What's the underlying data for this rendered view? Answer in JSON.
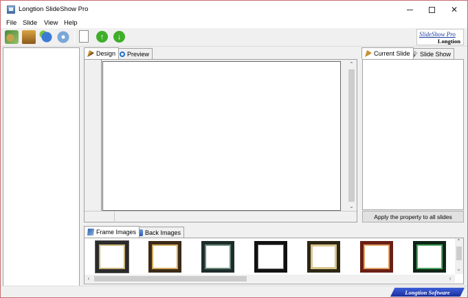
{
  "window": {
    "title": "Longtion SlideShow Pro"
  },
  "menu": {
    "items": [
      "File",
      "Slide",
      "View",
      "Help"
    ]
  },
  "toolbar": {
    "icons": [
      "open-project-icon",
      "save-project-icon",
      "publish-web-icon",
      "burn-disc-icon",
      "new-page-icon",
      "move-up-icon",
      "move-down-icon"
    ]
  },
  "logo": {
    "line1": "SlideShow Pro",
    "line2": "Longtion"
  },
  "center_tabs": [
    "Design",
    "Preview"
  ],
  "right_tabs": [
    "Current Slide",
    "Slide Show"
  ],
  "apply_button": "Apply the property to all slides",
  "bottom_tabs": [
    "Frame Images",
    "Back Images"
  ],
  "status": {
    "brand": "Longtion Software"
  }
}
